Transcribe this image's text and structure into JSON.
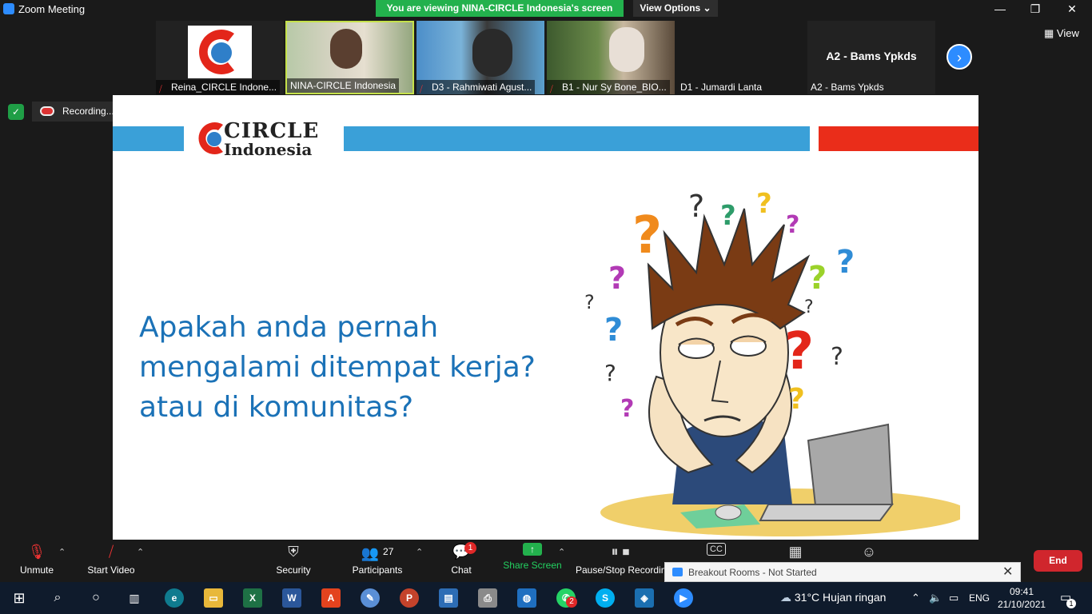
{
  "window": {
    "title": "Zoom Meeting",
    "share_banner": "You are viewing NINA-CIRCLE Indonesia's screen",
    "view_options": "View Options ⌄",
    "controls": {
      "minimize": "—",
      "restore": "❐",
      "close": "✕"
    }
  },
  "strip": {
    "view_label": "View",
    "active_speaker_label": "A2 - Bams Ypkds",
    "tiles": [
      {
        "name": "Reina_CIRCLE Indone...",
        "muted": true
      },
      {
        "name": "NINA-CIRCLE Indonesia",
        "muted": false
      },
      {
        "name": "D3 - Rahmiwati Agust...",
        "muted": true
      },
      {
        "name": "B1 - Nur Sy Bone_BIO...",
        "muted": true
      },
      {
        "name": "D1 - Jumardi Lanta",
        "muted": false
      },
      {
        "name": "A2 - Bams Ypkds",
        "muted": false
      }
    ],
    "next_arrow": "›"
  },
  "recording": {
    "label": "Recording...",
    "pause": "❚❚",
    "stop": "■"
  },
  "slide": {
    "logo_line1": "CIRCLE",
    "logo_line2": "Indonesia",
    "question_line1": "Apakah anda pernah",
    "question_line2": "mengalami ditempat kerja?",
    "question_line3": "atau di komunitas?",
    "colors": {
      "blue_bar": "#3aa0d8",
      "red_bar": "#ea2d1a",
      "text": "#1b72b7"
    }
  },
  "toolbar": {
    "unmute": "Unmute",
    "start_video": "Start Video",
    "security": "Security",
    "participants": "Participants",
    "participants_count": "27",
    "chat": "Chat",
    "chat_badge": "1",
    "share_screen": "Share Screen",
    "pause_recording": "Pause/Stop Recording",
    "end": "End",
    "breakout": "Breakout Rooms - Not Started"
  },
  "taskbar": {
    "weather": "31°C  Hujan ringan",
    "lang": "ENG",
    "time": "09:41",
    "date": "21/10/2021",
    "notification_count": "1",
    "whatsapp_badge": "2"
  }
}
